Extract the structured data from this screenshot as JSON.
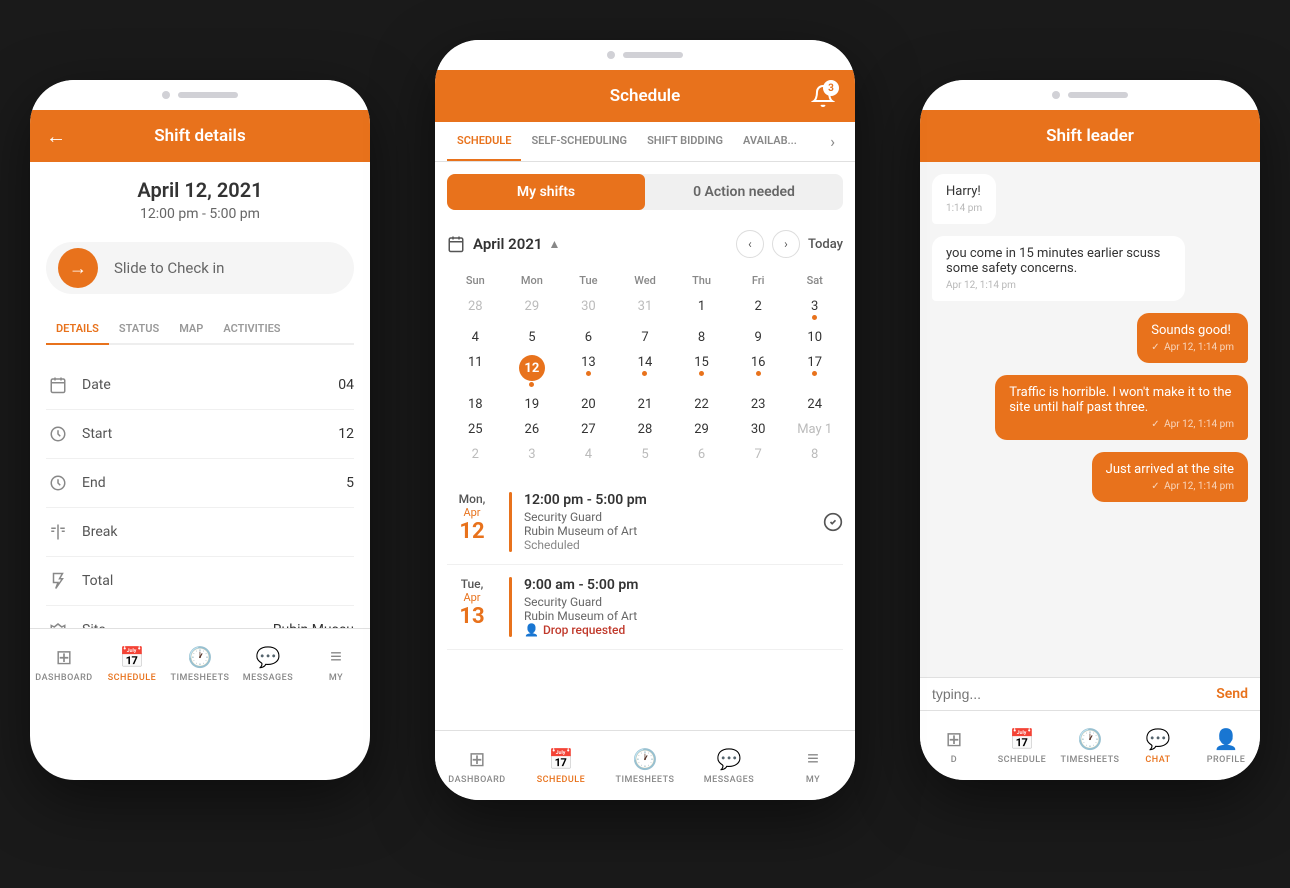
{
  "left_phone": {
    "header": {
      "title": "Shift details",
      "back_label": "←"
    },
    "shift": {
      "date": "April 12, 2021",
      "time": "12:00 pm - 5:00 pm"
    },
    "slide_checkin": "Slide to Check in",
    "tabs": [
      "DETAILS",
      "STATUS",
      "MAP",
      "ACTIVITIES"
    ],
    "active_tab": "DETAILS",
    "details": [
      {
        "icon": "calendar",
        "label": "Date",
        "value": "04"
      },
      {
        "icon": "clock",
        "label": "Start",
        "value": "12"
      },
      {
        "icon": "clock",
        "label": "End",
        "value": "5"
      },
      {
        "icon": "fork",
        "label": "Break",
        "value": ""
      },
      {
        "icon": "hourglass",
        "label": "Total",
        "value": ""
      },
      {
        "icon": "map",
        "label": "Site",
        "value": "Rubin Museu"
      }
    ],
    "bottom_nav": [
      {
        "icon": "dashboard",
        "label": "DASHBOARD"
      },
      {
        "icon": "schedule",
        "label": "SCHEDULE",
        "active": true
      },
      {
        "icon": "timesheets",
        "label": "TIMESHEETS"
      },
      {
        "icon": "messages",
        "label": "MESSAGES"
      },
      {
        "icon": "more",
        "label": "MY"
      }
    ]
  },
  "center_phone": {
    "header": {
      "title": "Schedule",
      "notification_count": "3"
    },
    "tabs": [
      "SCHEDULE",
      "SELF-SCHEDULING",
      "SHIFT BIDDING",
      "AVAILAB..."
    ],
    "active_tab": "SCHEDULE",
    "toggle": {
      "my_shifts": "My shifts",
      "action_needed": "0 Action needed"
    },
    "calendar": {
      "month": "April 2021",
      "today_label": "Today",
      "day_names": [
        "Sun",
        "Mon",
        "Tue",
        "Wed",
        "Thu",
        "Fri",
        "Sat"
      ],
      "weeks": [
        [
          "28",
          "29",
          "30",
          "31",
          "Apr 1",
          "2",
          "3"
        ],
        [
          "4",
          "5",
          "6",
          "7",
          "8",
          "9",
          "10"
        ],
        [
          "11",
          "12",
          "13",
          "14",
          "15",
          "16",
          "17"
        ],
        [
          "18",
          "19",
          "20",
          "21",
          "22",
          "23",
          "24"
        ],
        [
          "25",
          "26",
          "27",
          "28",
          "29",
          "30",
          "May 1"
        ],
        [
          "2",
          "3",
          "4",
          "5",
          "6",
          "7",
          "8"
        ]
      ],
      "dots": [
        "12",
        "13",
        "14",
        "15",
        "16",
        "17",
        "3"
      ],
      "today": "12"
    },
    "shifts": [
      {
        "dow": "Mon,",
        "month": "Apr",
        "day": "12",
        "time": "12:00 pm - 5:00 pm",
        "role": "Security Guard",
        "location": "Rubin Museum of Art",
        "status": "Scheduled",
        "has_check": true,
        "drop_requested": false
      },
      {
        "dow": "Tue,",
        "month": "Apr",
        "day": "13",
        "time": "9:00 am - 5:00 pm",
        "role": "Security Guard",
        "location": "Rubin Museum of Art",
        "status": "",
        "has_check": false,
        "drop_requested": true
      }
    ],
    "bottom_nav": [
      {
        "icon": "dashboard",
        "label": "DASHBOARD"
      },
      {
        "icon": "schedule",
        "label": "SCHEDULE",
        "active": true
      },
      {
        "icon": "timesheets",
        "label": "TIMESHEETS"
      },
      {
        "icon": "messages",
        "label": "MESSAGES"
      },
      {
        "icon": "more",
        "label": "MY"
      }
    ]
  },
  "right_phone": {
    "header": {
      "title": "Shift leader"
    },
    "messages": [
      {
        "type": "received",
        "text": "Harry!",
        "time": "1:14 pm"
      },
      {
        "type": "received",
        "text": "you come in 15 minutes earlier scuss some safety concerns.",
        "time": "Apr 12, 1:14 pm"
      },
      {
        "type": "sent",
        "text": "Sounds good!",
        "time": "Apr 12, 1:14 pm"
      },
      {
        "type": "sent",
        "text": "Traffic is horrible. I won't make it to the site until half past three.",
        "time": "Apr 12, 1:14 pm"
      },
      {
        "type": "sent",
        "text": "Just arrived at the site",
        "time": "Apr 12, 1:14 pm"
      }
    ],
    "input_placeholder": "typing...",
    "send_label": "Send",
    "bottom_nav": [
      {
        "icon": "dashboard",
        "label": "D"
      },
      {
        "icon": "schedule",
        "label": "SCHEDULE"
      },
      {
        "icon": "timesheets",
        "label": "TIMESHEETS"
      },
      {
        "icon": "chat",
        "label": "CHAT",
        "active": true
      },
      {
        "icon": "profile",
        "label": "PROFILE"
      }
    ]
  }
}
